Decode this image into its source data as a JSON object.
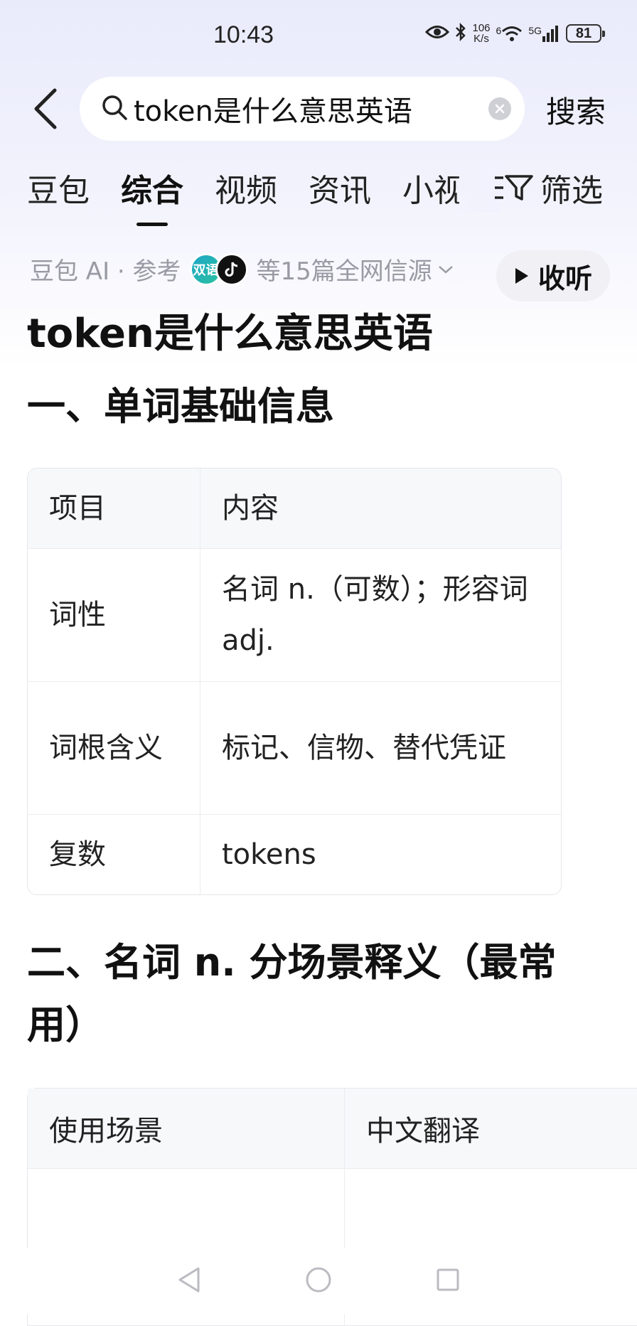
{
  "status_bar": {
    "time": "10:43",
    "net_speed_value": "106",
    "net_speed_unit": "K/s",
    "wifi_label": "6",
    "cell_label": "5G",
    "battery": "81"
  },
  "search": {
    "query": "token是什么意思英语",
    "button_label": "搜索"
  },
  "tabs": [
    {
      "label": "豆包"
    },
    {
      "label": "综合"
    },
    {
      "label": "视频"
    },
    {
      "label": "资讯"
    },
    {
      "label": "小视"
    }
  ],
  "filter_label": "筛选",
  "source": {
    "prefix": "豆包 AI · 参考",
    "count_text": "等15篇全网信源",
    "avatar1_text": "双语"
  },
  "listen_label": "收听",
  "answer": {
    "title": "token是什么意思英语",
    "section1": {
      "heading": "一、单词基础信息",
      "columns": [
        "项目",
        "内容"
      ],
      "rows": [
        {
          "item": "词性",
          "content": "名词 n.（可数）；形容词 adj."
        },
        {
          "item": "词根含义",
          "content": "标记、信物、替代凭证"
        },
        {
          "item": "复数",
          "content": "tokens"
        }
      ]
    },
    "section2": {
      "heading": "二、名词 n. 分场景释义（最常用）",
      "columns": [
        "使用场景",
        "中文翻译"
      ]
    }
  },
  "colors": {
    "accent": "#111111",
    "muted_text": "#9a9aa4",
    "header_bg": "#e9ebfb"
  }
}
